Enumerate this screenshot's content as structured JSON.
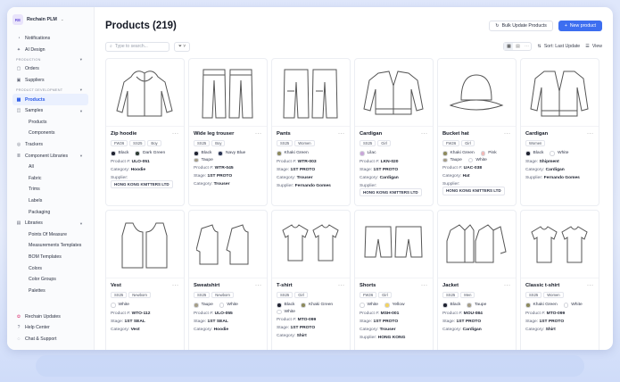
{
  "sidebar": {
    "brand_logo": "RE",
    "brand_name": "Rechain PLM",
    "top_items": [
      {
        "label": "Notifications",
        "icon": "bell-icon"
      },
      {
        "label": "AI Design",
        "icon": "sparkle-icon"
      }
    ],
    "section_production": "PRODUCTION",
    "production_items": [
      {
        "label": "Orders",
        "icon": "box-icon"
      },
      {
        "label": "Suppliers",
        "icon": "truck-icon"
      }
    ],
    "section_product_dev": "PRODUCT DEVELOPMENT",
    "products": "Products",
    "samples": "Samples",
    "samples_sub": [
      "Products",
      "Components"
    ],
    "trackers": "Trackers",
    "component_libraries": "Component Libraries",
    "component_sub": [
      "All",
      "Fabric",
      "Trims",
      "Labels",
      "Packaging"
    ],
    "libraries": "Libraries",
    "libraries_sub": [
      "Points Of Measure",
      "Measurements Templates",
      "BOM Templates",
      "Colors",
      "Color Groups",
      "Palettes"
    ],
    "footer": [
      {
        "label": "Rechain Updates",
        "icon": "gift-icon"
      },
      {
        "label": "Help Center",
        "icon": "help-icon"
      },
      {
        "label": "Chat & Support",
        "icon": "chat-icon"
      }
    ]
  },
  "header": {
    "title": "Products (219)",
    "bulk_update": "Bulk Update Products",
    "new_product": "New product"
  },
  "toolbar": {
    "search_placeholder": "Type to search...",
    "sort_label": "Sort: Last Update",
    "view_label": "View"
  },
  "labels": {
    "product_no": "Product #:",
    "category": "Category:",
    "stage": "Stage:",
    "supplier": "Supplier:"
  },
  "products": [
    {
      "name": "Zip hoodie",
      "sketch": "hoodie",
      "tags": [
        "FW26",
        "SS25",
        "Boy"
      ],
      "colors": [
        {
          "name": "Black",
          "hex": "#1f2230"
        },
        {
          "name": "Dark Green",
          "hex": "#2f3d34"
        }
      ],
      "fields": [
        [
          "Product #:",
          "ULO-051"
        ],
        [
          "Category:",
          "Hoodie"
        ]
      ],
      "supplier": "HONG KONG KNITTERS LTD"
    },
    {
      "name": "Wide leg trouser",
      "sketch": "trouser",
      "tags": [
        "SS25",
        "Boy"
      ],
      "colors": [
        {
          "name": "Black",
          "hex": "#1f2230"
        },
        {
          "name": "Navy Blue",
          "hex": "#2a3452"
        },
        {
          "name": "Taupe",
          "hex": "#a59e87"
        }
      ],
      "fields": [
        [
          "Product #:",
          "WTR-045"
        ],
        [
          "Stage:",
          "1ST PROTO"
        ],
        [
          "Category:",
          "Trouser"
        ]
      ],
      "supplier": ""
    },
    {
      "name": "Pants",
      "sketch": "pants",
      "tags": [
        "SS25",
        "Women"
      ],
      "colors": [
        {
          "name": "Khaki Green",
          "hex": "#8d8a5c"
        }
      ],
      "fields": [
        [
          "Product #:",
          "WTR-003"
        ],
        [
          "Stage:",
          "1ST PROTO"
        ],
        [
          "Category:",
          "Trouser"
        ],
        [
          "Supplier:",
          "Fernando Gomes"
        ]
      ],
      "supplier": ""
    },
    {
      "name": "Cardigan",
      "sketch": "cardigan",
      "tags": [
        "SS25",
        "Girl"
      ],
      "colors": [
        {
          "name": "Lilac",
          "hex": "#c9a6d8"
        }
      ],
      "fields": [
        [
          "Product #:",
          "LKN-020"
        ],
        [
          "Stage:",
          "1ST PROTO"
        ],
        [
          "Category:",
          "Cardigan"
        ]
      ],
      "supplier": "HONG KONG KNITTERS LTD"
    },
    {
      "name": "Bucket hat",
      "sketch": "hat",
      "tags": [
        "FW26",
        "Girl"
      ],
      "colors": [
        {
          "name": "Khaki Green",
          "hex": "#8d8a5c"
        },
        {
          "name": "Pink",
          "hex": "#f2b8b5"
        },
        {
          "name": "Taupe",
          "hex": "#a59e87"
        },
        {
          "name": "White",
          "hex": "#ffffff"
        }
      ],
      "fields": [
        [
          "Product #:",
          "UAC-038"
        ],
        [
          "Category:",
          "Hat"
        ]
      ],
      "supplier": "HONG KONG KNITTERS LTD"
    },
    {
      "name": "Cardigan",
      "sketch": "cardigan2",
      "tags": [
        "Women"
      ],
      "colors": [
        {
          "name": "Black",
          "hex": "#1f2230"
        },
        {
          "name": "White",
          "hex": "#ffffff"
        }
      ],
      "fields": [
        [
          "Stage:",
          "Shipment"
        ],
        [
          "Category:",
          "Cardigan"
        ],
        [
          "Supplier:",
          "Fernando Gomes"
        ]
      ],
      "supplier": ""
    },
    {
      "name": "Vest",
      "sketch": "vest",
      "tags": [
        "SS25",
        "Newborn"
      ],
      "colors": [
        {
          "name": "White",
          "hex": "#ffffff"
        }
      ],
      "fields": [
        [
          "Product #:",
          "WTO-112"
        ],
        [
          "Stage:",
          "1ST SEAL"
        ],
        [
          "Category:",
          "Vest"
        ]
      ],
      "supplier": ""
    },
    {
      "name": "Sweatshirt",
      "sketch": "sweatshirt",
      "tags": [
        "SS25",
        "Newborn"
      ],
      "colors": [
        {
          "name": "Taupe",
          "hex": "#a59e87"
        },
        {
          "name": "White",
          "hex": "#ffffff"
        }
      ],
      "fields": [
        [
          "Product #:",
          "ULO-055"
        ],
        [
          "Stage:",
          "1ST SEAL"
        ],
        [
          "Category:",
          "Hoodie"
        ]
      ],
      "supplier": ""
    },
    {
      "name": "T-shirt",
      "sketch": "tshirt",
      "tags": [
        "SS25",
        "Girl"
      ],
      "colors": [
        {
          "name": "Black",
          "hex": "#1f2230"
        },
        {
          "name": "Khaki Green",
          "hex": "#8d8a5c"
        },
        {
          "name": "White",
          "hex": "#ffffff"
        }
      ],
      "fields": [
        [
          "Product #:",
          "MTO-099"
        ],
        [
          "Stage:",
          "1ST PROTO"
        ],
        [
          "Category:",
          "Shirt"
        ]
      ],
      "supplier": ""
    },
    {
      "name": "Shorts",
      "sketch": "shorts",
      "tags": [
        "FW26",
        "Girl"
      ],
      "colors": [
        {
          "name": "White",
          "hex": "#ffffff"
        },
        {
          "name": "Yellow",
          "hex": "#f4d35e"
        }
      ],
      "fields": [
        [
          "Product #:",
          "MSH-001"
        ],
        [
          "Stage:",
          "1ST PROTO"
        ],
        [
          "Category:",
          "Trouser"
        ],
        [
          "Supplier:",
          "HONG KONG"
        ]
      ],
      "supplier": ""
    },
    {
      "name": "Jacket",
      "sketch": "jacket",
      "tags": [
        "SS25",
        "Men"
      ],
      "colors": [
        {
          "name": "Black",
          "hex": "#1f2230"
        },
        {
          "name": "Taupe",
          "hex": "#a59e87"
        }
      ],
      "fields": [
        [
          "Product #:",
          "MOU-084"
        ],
        [
          "Stage:",
          "1ST PROTO"
        ],
        [
          "Category:",
          "Cardigan"
        ]
      ],
      "supplier": ""
    },
    {
      "name": "Classic t-shirt",
      "sketch": "tshirt2",
      "tags": [
        "SS25",
        "Women"
      ],
      "colors": [
        {
          "name": "Khaki Green",
          "hex": "#8d8a5c"
        },
        {
          "name": "White",
          "hex": "#ffffff"
        }
      ],
      "fields": [
        [
          "Product #:",
          "MTO-099"
        ],
        [
          "Stage:",
          "1ST PROTO"
        ],
        [
          "Category:",
          "Shirt"
        ]
      ],
      "supplier": ""
    }
  ]
}
